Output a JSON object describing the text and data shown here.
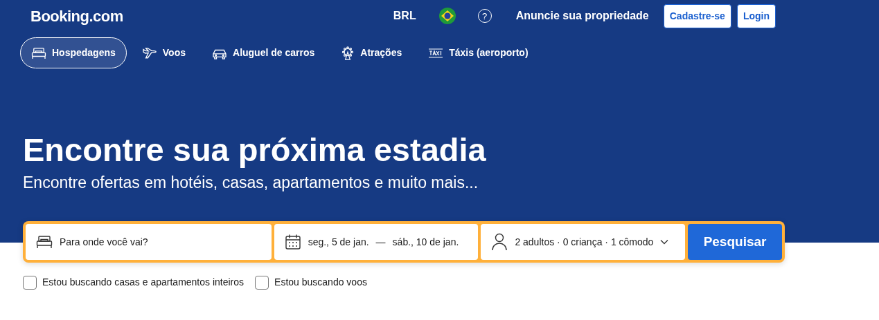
{
  "header": {
    "logo": "Booking.com",
    "currency": "BRL",
    "help": "?",
    "list_property": "Anuncie sua propriedade",
    "buttons": [
      "Cadastre-se",
      "Login"
    ]
  },
  "tabs": [
    {
      "label": "Hospedagens",
      "kind": "bed",
      "selected": true
    },
    {
      "label": "Voos",
      "kind": "plane",
      "selected": false
    },
    {
      "label": "Aluguel de carros",
      "kind": "car",
      "selected": false
    },
    {
      "label": "Atrações",
      "kind": "wheel",
      "selected": false
    },
    {
      "label": "Táxis (aeroporto)",
      "kind": "taxi",
      "selected": false
    }
  ],
  "hero": {
    "title": "Encontre sua próxima estadia",
    "subtitle": "Encontre ofertas em hotéis, casas, apartamentos e muito mais..."
  },
  "search": {
    "destination": {
      "placeholder": "Para onde você vai?"
    },
    "check_in": "seg., 5 de jan.",
    "separator": "—",
    "check_out": "sáb., 10 de jan.",
    "guests": "2 adultos · 0 criança · 1 cômodo",
    "button": "Pesquisar"
  },
  "options": [
    {
      "label": "Estou buscando casas e apartamentos inteiros",
      "checked": false
    },
    {
      "label": "Estou buscando voos",
      "checked": false
    }
  ]
}
